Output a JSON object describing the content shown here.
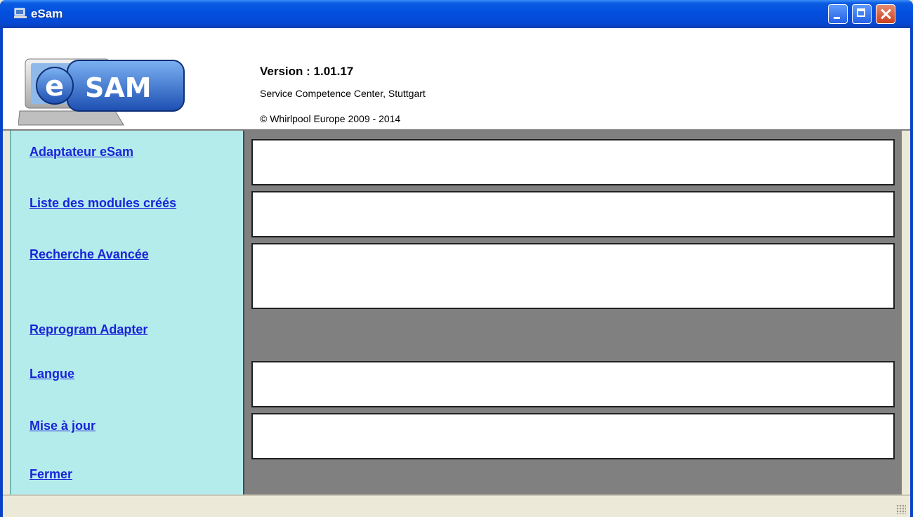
{
  "window": {
    "title": "eSam"
  },
  "header": {
    "logo_text": "eSAM",
    "version": "Version : 1.01.17",
    "company": "Service Competence Center, Stuttgart",
    "copyright": "© Whirlpool Europe 2009 - 2014"
  },
  "nav": {
    "items": [
      {
        "label": "Adaptateur eSam"
      },
      {
        "label": "Liste des modules créés"
      },
      {
        "label": "Recherche Avancée"
      },
      {
        "label": "Reprogram Adapter"
      },
      {
        "label": "Langue"
      },
      {
        "label": "Mise à jour"
      },
      {
        "label": "Fermer"
      }
    ]
  },
  "colors": {
    "nav_background": "#b4ecec",
    "link": "#1a24d8",
    "content_background": "#808080",
    "titlebar": "#0451df"
  }
}
